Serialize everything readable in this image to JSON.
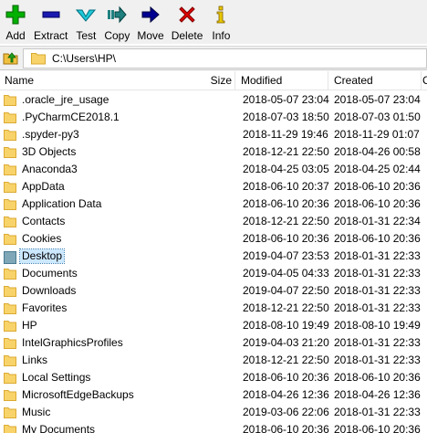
{
  "toolbar": {
    "buttons": [
      {
        "label": "Add",
        "icon": "plus-icon",
        "color": "#00a000"
      },
      {
        "label": "Extract",
        "icon": "minus-icon",
        "color": "#1a1ab0"
      },
      {
        "label": "Test",
        "icon": "check-icon",
        "color": "#00b4c8"
      },
      {
        "label": "Copy",
        "icon": "copy-arrow-icon",
        "color": "#208080"
      },
      {
        "label": "Move",
        "icon": "move-arrow-icon",
        "color": "#000080"
      },
      {
        "label": "Delete",
        "icon": "x-icon",
        "color": "#e00000"
      },
      {
        "label": "Info",
        "icon": "info-icon",
        "color": "#e0c000"
      }
    ]
  },
  "address": {
    "path": "C:\\Users\\HP\\"
  },
  "columns": {
    "name": "Name",
    "size": "Size",
    "modified": "Modified",
    "created": "Created",
    "more": "C"
  },
  "files": [
    {
      "name": ".oracle_jre_usage",
      "modified": "2018-05-07 23:04",
      "created": "2018-05-07 23:04"
    },
    {
      "name": ".PyCharmCE2018.1",
      "modified": "2018-07-03 18:50",
      "created": "2018-07-03 01:50"
    },
    {
      "name": ".spyder-py3",
      "modified": "2018-11-29 19:46",
      "created": "2018-11-29 01:07"
    },
    {
      "name": "3D Objects",
      "modified": "2018-12-21 22:50",
      "created": "2018-04-26 00:58"
    },
    {
      "name": "Anaconda3",
      "modified": "2018-04-25 03:05",
      "created": "2018-04-25 02:44"
    },
    {
      "name": "AppData",
      "modified": "2018-06-10 20:37",
      "created": "2018-06-10 20:36"
    },
    {
      "name": "Application Data",
      "modified": "2018-06-10 20:36",
      "created": "2018-06-10 20:36"
    },
    {
      "name": "Contacts",
      "modified": "2018-12-21 22:50",
      "created": "2018-01-31 22:34"
    },
    {
      "name": "Cookies",
      "modified": "2018-06-10 20:36",
      "created": "2018-06-10 20:36"
    },
    {
      "name": "Desktop",
      "modified": "2019-04-07 23:53",
      "created": "2018-01-31 22:33",
      "selected": true
    },
    {
      "name": "Documents",
      "modified": "2019-04-05 04:33",
      "created": "2018-01-31 22:33"
    },
    {
      "name": "Downloads",
      "modified": "2019-04-07 22:50",
      "created": "2018-01-31 22:33"
    },
    {
      "name": "Favorites",
      "modified": "2018-12-21 22:50",
      "created": "2018-01-31 22:33"
    },
    {
      "name": "HP",
      "modified": "2018-08-10 19:49",
      "created": "2018-08-10 19:49"
    },
    {
      "name": "IntelGraphicsProfiles",
      "modified": "2019-04-03 21:20",
      "created": "2018-01-31 22:33"
    },
    {
      "name": "Links",
      "modified": "2018-12-21 22:50",
      "created": "2018-01-31 22:33"
    },
    {
      "name": "Local Settings",
      "modified": "2018-06-10 20:36",
      "created": "2018-06-10 20:36"
    },
    {
      "name": "MicrosoftEdgeBackups",
      "modified": "2018-04-26 12:36",
      "created": "2018-04-26 12:36"
    },
    {
      "name": "Music",
      "modified": "2019-03-06 22:06",
      "created": "2018-01-31 22:33"
    },
    {
      "name": "My Documents",
      "modified": "2018-06-10 20:36",
      "created": "2018-06-10 20:36"
    }
  ]
}
